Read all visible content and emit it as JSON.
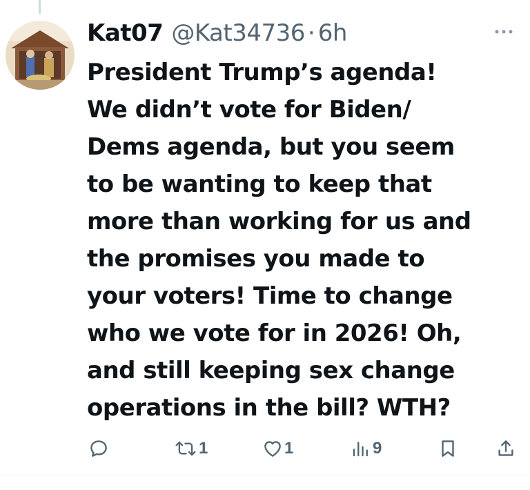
{
  "tweet": {
    "display_name": "Kat07",
    "handle": "@Kat34736",
    "separator": "·",
    "timestamp": "6h",
    "text": "President Trump’s agenda!\nWe didn’t vote for Biden/\nDems agenda, but you seem\nto be wanting to keep that\nmore than working for us and\nthe promises you made to\nyour voters! Time to change\nwho we vote for in 2026! Oh,\nand still keeping sex change\noperations in the bill? WTH?"
  },
  "actions": {
    "reply": {
      "icon": "reply-icon",
      "count": ""
    },
    "retweet": {
      "icon": "retweet-icon",
      "count": "1"
    },
    "like": {
      "icon": "heart-icon",
      "count": "1"
    },
    "views": {
      "icon": "views-icon",
      "count": "9"
    },
    "bookmark": {
      "icon": "bookmark-icon"
    },
    "share": {
      "icon": "share-icon"
    }
  },
  "colors": {
    "text_primary": "#0f1419",
    "text_secondary": "#536471",
    "thread_line": "#cfd9de",
    "divider": "#eff3f4"
  }
}
